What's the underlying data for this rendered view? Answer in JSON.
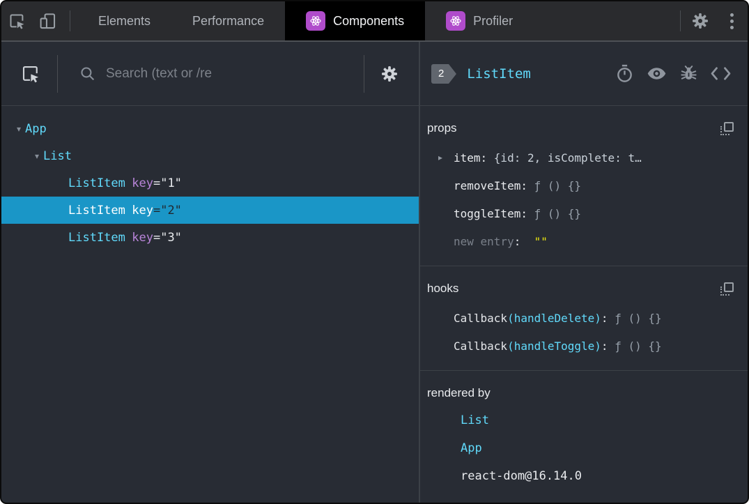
{
  "toolbar": {
    "tabs": [
      {
        "label": "Elements",
        "active": false,
        "icon": false
      },
      {
        "label": "Performance",
        "active": false,
        "icon": false
      },
      {
        "label": "Components",
        "active": true,
        "icon": true
      },
      {
        "label": "Profiler",
        "active": false,
        "icon": true
      }
    ],
    "accent_purple": "#b04ccb"
  },
  "left_panel": {
    "search_placeholder": "Search (text or /re",
    "tree": [
      {
        "name": "App",
        "depth": 0,
        "expanded": true,
        "selected": false
      },
      {
        "name": "List",
        "depth": 1,
        "expanded": true,
        "selected": false
      },
      {
        "name": "ListItem",
        "depth": 2,
        "attr": "key",
        "eq": "=",
        "value": "\"1\"",
        "selected": false
      },
      {
        "name": "ListItem",
        "depth": 2,
        "attr": "key",
        "eq": "=",
        "value": "\"2\"",
        "selected": true
      },
      {
        "name": "ListItem",
        "depth": 2,
        "attr": "key",
        "eq": "=",
        "value": "\"3\"",
        "selected": false
      }
    ],
    "selected_color": "#1a96c7"
  },
  "right_panel": {
    "badge": "2",
    "component_name": "ListItem",
    "sections": {
      "props": {
        "title": "props",
        "has_copy": true,
        "rows": [
          {
            "name": "item",
            "colon": ":",
            "value": "{id: 2, isComplete: t…",
            "kind": "preview",
            "expandable": true
          },
          {
            "name": "removeItem",
            "colon": ":",
            "value": "ƒ () {}",
            "kind": "fn",
            "expandable": false
          },
          {
            "name": "toggleItem",
            "colon": ":",
            "value": "ƒ () {}",
            "kind": "fn",
            "expandable": false
          },
          {
            "name": "new entry",
            "colon": ":",
            "value": "\"\"",
            "kind": "new",
            "expandable": false
          }
        ]
      },
      "hooks": {
        "title": "hooks",
        "has_copy": true,
        "rows": [
          {
            "fn": "Callback",
            "arg": "(handleDelete)",
            "colon": ":",
            "value": "ƒ () {}"
          },
          {
            "fn": "Callback",
            "arg": "(handleToggle)",
            "colon": ":",
            "value": "ƒ () {}"
          }
        ]
      },
      "rendered_by": {
        "title": "rendered by",
        "has_copy": false,
        "rows": [
          {
            "label": "List",
            "link": true
          },
          {
            "label": "App",
            "link": true
          },
          {
            "label": "react-dom@16.14.0",
            "link": false
          }
        ]
      }
    },
    "accent_cyan": "#61dafb",
    "string_yellow": "#e8e410"
  }
}
